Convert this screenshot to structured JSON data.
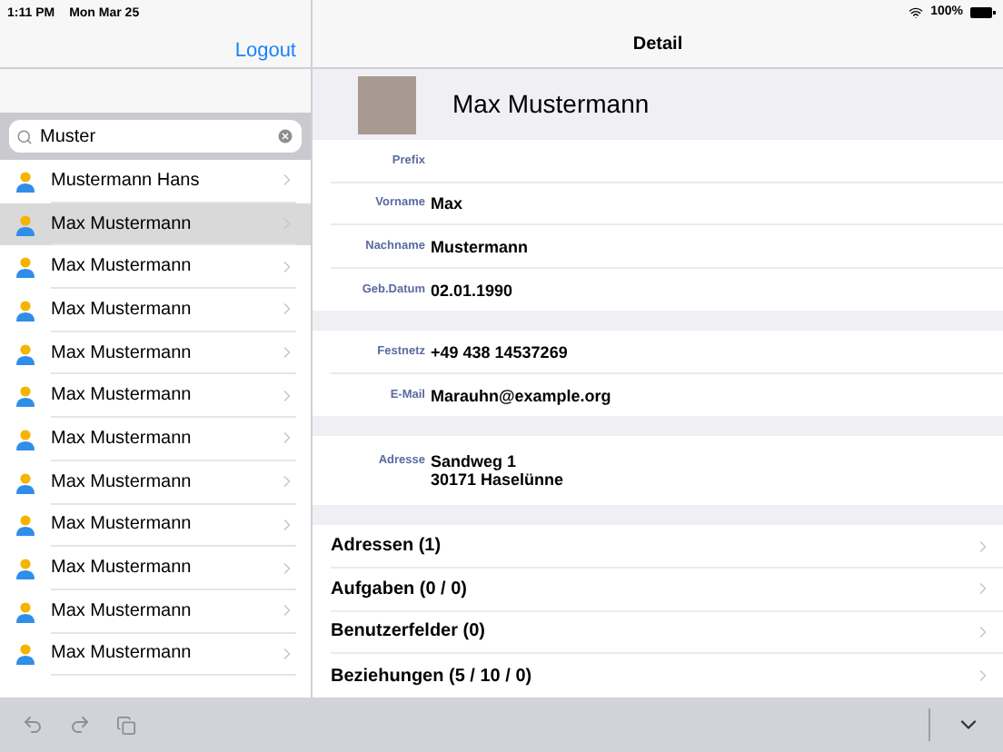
{
  "status_bar": {
    "time": "1:11 PM",
    "date": "Mon Mar 25",
    "battery": "100%"
  },
  "nav": {
    "logout": "Logout",
    "title": "Detail"
  },
  "search": {
    "value": "Muster"
  },
  "contacts": [
    {
      "name": "Mustermann Hans",
      "selected": false
    },
    {
      "name": "Max Mustermann",
      "selected": true
    },
    {
      "name": "Max Mustermann",
      "selected": false
    },
    {
      "name": "Max Mustermann",
      "selected": false
    },
    {
      "name": "Max Mustermann",
      "selected": false
    },
    {
      "name": "Max Mustermann",
      "selected": false
    },
    {
      "name": "Max Mustermann",
      "selected": false
    },
    {
      "name": "Max Mustermann",
      "selected": false
    },
    {
      "name": "Max Mustermann",
      "selected": false
    },
    {
      "name": "Max Mustermann",
      "selected": false
    },
    {
      "name": "Max Mustermann",
      "selected": false
    },
    {
      "name": "Max Mustermann",
      "selected": false
    }
  ],
  "detail": {
    "name": "Max Mustermann",
    "groups": [
      [
        {
          "label": "Prefix"
        },
        {
          "label": "Vorname",
          "value": "Max"
        },
        {
          "label": "Nachname",
          "value": "Mustermann"
        },
        {
          "label": "Geb.Datum",
          "value": "02.01.1990"
        }
      ],
      [
        {
          "label": "Festnetz",
          "value": "+49 438 14537269"
        },
        {
          "label": "E-Mail",
          "value": "Marauhn@example.org"
        }
      ],
      [
        {
          "label": "Adresse",
          "value": "Sandweg 1\n30171 Haselünne"
        }
      ]
    ],
    "links": [
      "Adressen (1)",
      "Aufgaben (0 / 0)",
      "Benutzerfelder (0)",
      "Beziehungen (5 / 10 / 0)"
    ]
  }
}
